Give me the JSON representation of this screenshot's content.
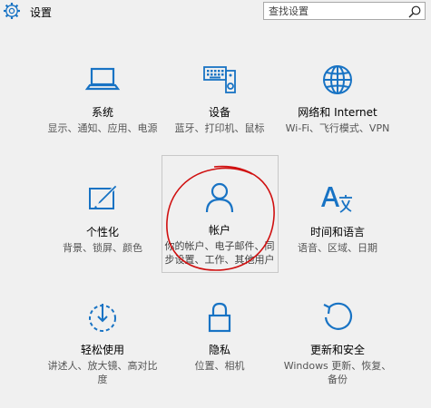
{
  "window": {
    "title": "设置"
  },
  "search": {
    "placeholder": "查找设置"
  },
  "colors": {
    "accent": "#1873c4",
    "annotation": "#d01010"
  },
  "tiles": [
    {
      "name": "系统",
      "desc": "显示、通知、应用、电源",
      "icon": "laptop-icon"
    },
    {
      "name": "设备",
      "desc": "蓝牙、打印机、鼠标",
      "icon": "keyboard-speaker-icon"
    },
    {
      "name": "网络和 Internet",
      "desc": "Wi-Fi、飞行模式、VPN",
      "icon": "globe-icon"
    },
    {
      "name": "个性化",
      "desc": "背景、锁屏、颜色",
      "icon": "paint-monitor-icon"
    },
    {
      "name": "帐户",
      "desc": "你的帐户、电子邮件、同步设置、工作、其他用户",
      "icon": "person-icon"
    },
    {
      "name": "时间和语言",
      "desc": "语音、区域、日期",
      "icon": "language-icon"
    },
    {
      "name": "轻松使用",
      "desc": "讲述人、放大镜、高对比度",
      "icon": "ease-of-access-icon"
    },
    {
      "name": "隐私",
      "desc": "位置、相机",
      "icon": "lock-icon"
    },
    {
      "name": "更新和安全",
      "desc": "Windows 更新、恢复、备份",
      "icon": "refresh-icon"
    }
  ]
}
